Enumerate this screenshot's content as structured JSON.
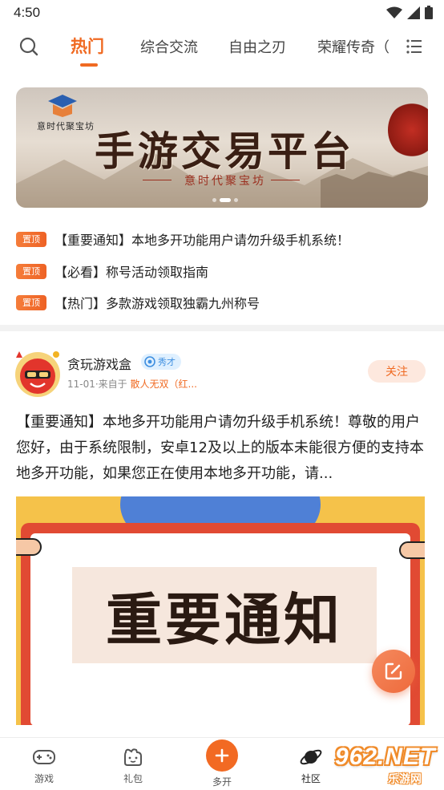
{
  "status_bar": {
    "time": "4:50"
  },
  "tabs": [
    {
      "label": "热门",
      "active": true
    },
    {
      "label": "综合交流",
      "active": false
    },
    {
      "label": "自由之刃",
      "active": false
    },
    {
      "label": "荣耀传奇（",
      "active": false
    }
  ],
  "banner": {
    "brand": "意时代聚宝坊",
    "title": "手游交易平台",
    "subtitle": "意时代聚宝坊"
  },
  "notices": [
    {
      "badge": "置顶",
      "text": "【重要通知】本地多开功能用户请勿升级手机系统！"
    },
    {
      "badge": "置顶",
      "text": "【必看】称号活动领取指南"
    },
    {
      "badge": "置顶",
      "text": "【热门】多款游戏领取独霸九州称号"
    }
  ],
  "post": {
    "author": "贪玩游戏盒",
    "level": "秀才",
    "date_prefix": "11-01·来自于",
    "source": "散人无双（红...",
    "follow_label": "关注",
    "body": "【重要通知】本地多开功能用户请勿升级手机系统！尊敬的用户您好，由于系统限制，安卓12及以上的版本未能很方便的支持本地多开功能，如果您正在使用本地多开功能，请...",
    "image_title": "重要通知"
  },
  "bottom_nav": [
    {
      "label": "游戏",
      "icon": "gamepad-icon"
    },
    {
      "label": "礼包",
      "icon": "gift-icon"
    },
    {
      "label": "多开",
      "icon": "plus-icon"
    },
    {
      "label": "社区",
      "icon": "planet-icon",
      "active": true
    }
  ],
  "watermark": {
    "number": "962.NET",
    "site": "乐游网"
  },
  "colors": {
    "accent": "#f06a22",
    "divider": "#f2f2f2",
    "badge_blue": "#3f8fe0"
  }
}
